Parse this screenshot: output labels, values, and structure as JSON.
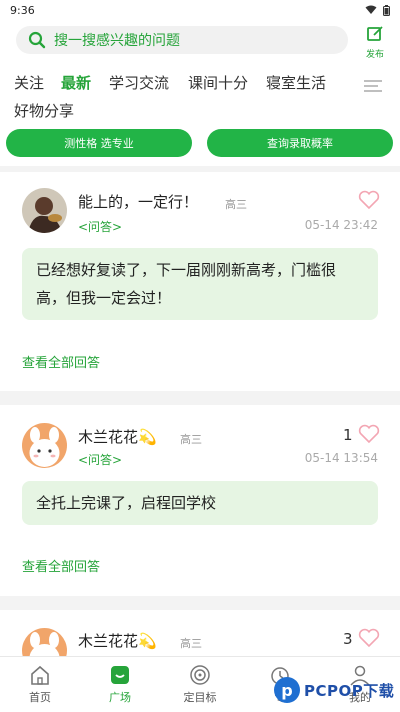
{
  "status": {
    "time": "9:36"
  },
  "search": {
    "placeholder": "搜一搜感兴趣的问题"
  },
  "publish": {
    "label": "发布"
  },
  "tabs": [
    {
      "label": "关注",
      "active": false
    },
    {
      "label": "最新",
      "active": true
    },
    {
      "label": "学习交流",
      "active": false
    },
    {
      "label": "课间十分",
      "active": false
    },
    {
      "label": "寝室生活",
      "active": false
    },
    {
      "label": "好物分享",
      "active": false
    }
  ],
  "actions": {
    "left": "测性格 选专业",
    "right": "查询录取概率"
  },
  "posts": [
    {
      "name": "能上的，一定行！",
      "grade": "高三",
      "tag": "<问答>",
      "time": "05-14 23:42",
      "likes": "",
      "content": "已经想好复读了，下一届刚刚新高考，门槛很高，但我一定会过！",
      "view_all": "查看全部回答"
    },
    {
      "name": "木兰花花💫",
      "grade": "高三",
      "tag": "<问答>",
      "time": "05-14 13:54",
      "likes": "1",
      "content": "全托上完课了，启程回学校",
      "view_all": "查看全部回答"
    },
    {
      "name": "木兰花花💫",
      "grade": "高三",
      "likes": "3"
    }
  ],
  "nav": [
    {
      "label": "首页",
      "icon": "home-icon",
      "active": false
    },
    {
      "label": "广场",
      "icon": "square-icon",
      "active": true
    },
    {
      "label": "定目标",
      "icon": "target-icon",
      "active": false
    },
    {
      "label": "专",
      "icon": "alarm-icon",
      "active": false
    },
    {
      "label": "我的",
      "icon": "user-icon",
      "active": false
    }
  ],
  "watermark": {
    "text": "PCPOP下载"
  },
  "colors": {
    "accent": "#26a43a",
    "button": "#22b447",
    "bubble": "#e6f5e3",
    "heart": "#f3a6b3"
  }
}
